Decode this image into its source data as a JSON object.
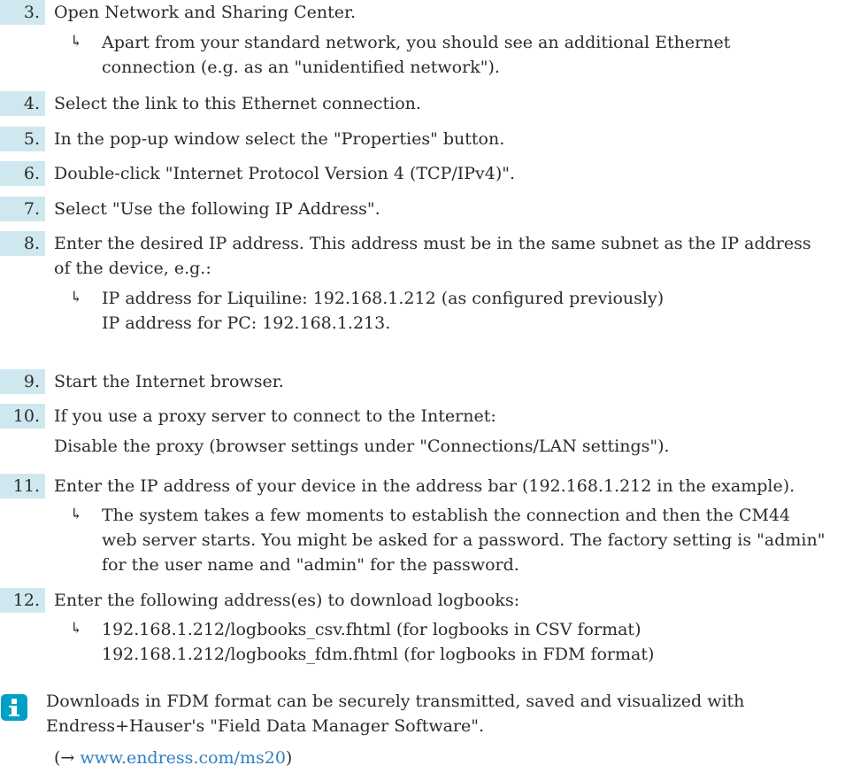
{
  "steps": [
    {
      "num": "3.",
      "lines": [
        "Open Network and Sharing Center."
      ],
      "result": [
        "Apart from your standard network, you should see an additional Ethernet",
        "connection (e.g. as an \"unidentified network\")."
      ]
    },
    {
      "num": "4.",
      "lines": [
        "Select the link to this Ethernet connection."
      ]
    },
    {
      "num": "5.",
      "lines": [
        "In the pop-up window select the \"Properties\" button."
      ]
    },
    {
      "num": "6.",
      "lines": [
        "Double-click \"Internet Protocol Version 4 (TCP/IPv4)\"."
      ]
    },
    {
      "num": "7.",
      "lines": [
        "Select \"Use the following IP Address\"."
      ]
    },
    {
      "num": "8.",
      "lines": [
        "Enter the desired IP address. This address must be in the same subnet as the IP address",
        "of the device, e.g.:"
      ],
      "result": [
        "IP address for Liquiline: 192.168.1.212 (as configured previously)",
        "IP address for PC: 192.168.1.213."
      ]
    },
    {
      "num": "9.",
      "lines": [
        "Start the Internet browser."
      ]
    },
    {
      "num": "10.",
      "lines": [
        "If you use a proxy server to connect to the Internet:",
        "Disable the proxy (browser settings under \"Connections/LAN settings\")."
      ]
    },
    {
      "num": "11.",
      "lines": [
        "Enter the IP address of your device in the address bar (192.168.1.212 in the example)."
      ],
      "result": [
        "The system takes a few moments to establish the connection and then the CM44",
        "web server starts. You might be asked for a password. The factory setting is \"admin\"",
        "for the user name and \"admin\" for the password."
      ]
    },
    {
      "num": "12.",
      "lines": [
        "Enter the following address(es) to download logbooks:"
      ],
      "result": [
        "192.168.1.212/logbooks_csv.fhtml (for logbooks in CSV format)",
        "192.168.1.212/logbooks_fdm.fhtml (for logbooks in FDM format)"
      ]
    }
  ],
  "result_arrow": "↳",
  "note": {
    "icon": "info-icon",
    "accent_color": "#00a0c6",
    "lines": [
      "Downloads in FDM format can be securely transmitted, saved and visualized with",
      "Endress+Hauser's \"Field Data Manager Software\"."
    ],
    "ref_prefix": "(→ ",
    "ref_link": "www.endress.com/ms20",
    "ref_suffix": ")"
  },
  "colors": {
    "step_number_bg": "#cfe8ef",
    "link": "#2f7fc1",
    "text": "#2b2b2b"
  }
}
